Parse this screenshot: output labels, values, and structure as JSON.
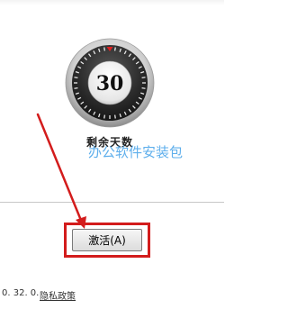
{
  "countdown": {
    "days_value": "30",
    "label": "剩余天数"
  },
  "watermark": {
    "text": "办公软件安装包"
  },
  "actions": {
    "activate_label": "激活(A)"
  },
  "footer": {
    "version": "0. 32. 0.",
    "privacy_link": "隐私政策"
  },
  "colors": {
    "annotation_red": "#d31c1c",
    "gauge_marker": "#e02020",
    "watermark_blue": "#4ea7ea"
  }
}
